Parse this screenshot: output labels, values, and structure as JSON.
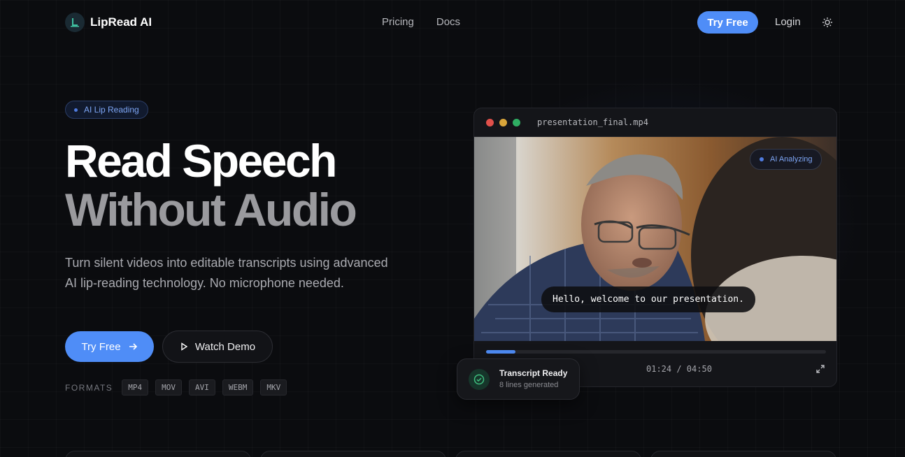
{
  "nav": {
    "brand": "LipRead AI",
    "links": [
      "Pricing",
      "Docs"
    ],
    "try_label": "Try Free",
    "login_label": "Login"
  },
  "hero": {
    "badge": "AI Lip Reading",
    "title_line1": "Read Speech",
    "title_line2": "Without Audio",
    "subtitle": "Turn silent videos into editable transcripts using advanced AI lip-reading technology. No microphone needed.",
    "try_label": "Try Free",
    "demo_label": "Watch Demo",
    "formats_label": "FORMATS",
    "formats": [
      "MP4",
      "MOV",
      "AVI",
      "WEBM",
      "MKV"
    ]
  },
  "player": {
    "filename": "presentation_final.mp4",
    "status_badge": "AI Analyzing",
    "caption": "Hello, welcome to our presentation.",
    "timecode": "01:24 / 04:50",
    "progress": 0.086
  },
  "toast": {
    "title": "Transcript Ready",
    "subtitle": "8 lines generated"
  },
  "colors": {
    "accent": "#4f8df7",
    "background": "#0b0c0f",
    "dot_red": "#e0504a",
    "dot_yellow": "#d9a53a",
    "dot_green": "#2fae63",
    "success": "#3fbf7f"
  },
  "icons": [
    "logo-icon",
    "sun-icon",
    "arrow-right-icon",
    "play-icon",
    "expand-icon",
    "check-circle-icon"
  ]
}
